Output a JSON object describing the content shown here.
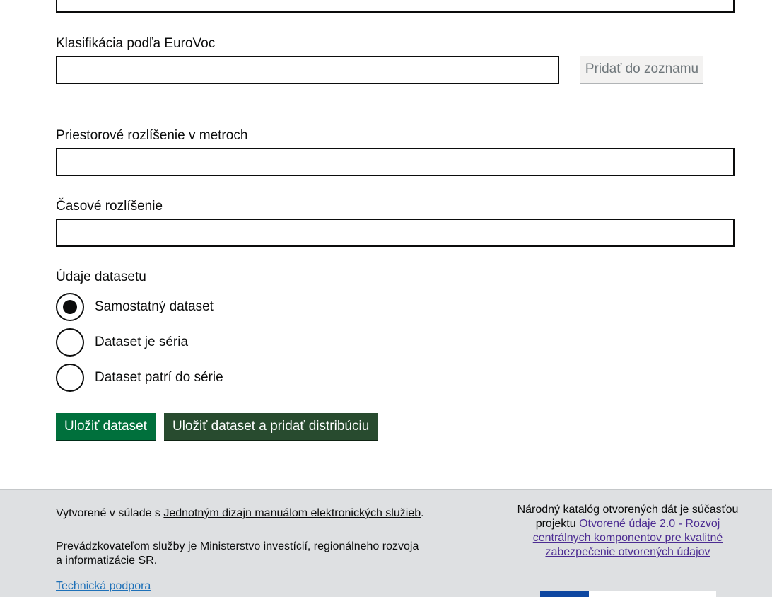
{
  "form": {
    "eurovoc_label": "Klasifikácia podľa EuroVoc",
    "eurovoc_value": "",
    "add_to_list_label": "Pridať do zoznamu",
    "spatial_label": "Priestorové rozlíšenie v metroch",
    "spatial_value": "",
    "temporal_label": "Časové rozlíšenie",
    "temporal_value": "",
    "dataset_type_label": "Údaje datasetu",
    "dataset_type_options": [
      {
        "label": "Samostatný dataset",
        "checked": true
      },
      {
        "label": "Dataset je séria",
        "checked": false
      },
      {
        "label": "Dataset patrí do série",
        "checked": false
      }
    ],
    "save_label": "Uložiť dataset",
    "save_and_add_label": "Uložiť dataset a pridať distribúciu"
  },
  "footer": {
    "created_prefix": "Vytvorené v súlade s ",
    "design_manual_link": "Jednotným dizajn manuálom elektronických služieb",
    "created_suffix": ".",
    "operator_text": "Prevádzkovateľom služby je Ministerstvo investícií, regionálneho rozvoja a informatizácie SR.",
    "support_link": "Technická podpora",
    "catalog_prefix": "Národný katalóg otvorených dát je súčasťou projektu ",
    "project_link": "Otvorené údaje 2.0 - Rozvoj centrálnych komponentov pre kvalitné zabezpečenie otvorených údajov"
  },
  "colors": {
    "save_button": "#00703c",
    "save_and_add_button": "#284b2f",
    "footer_bg": "#dee0e2",
    "link_blue": "#1d70b8",
    "link_visited": "#4c2c92"
  }
}
